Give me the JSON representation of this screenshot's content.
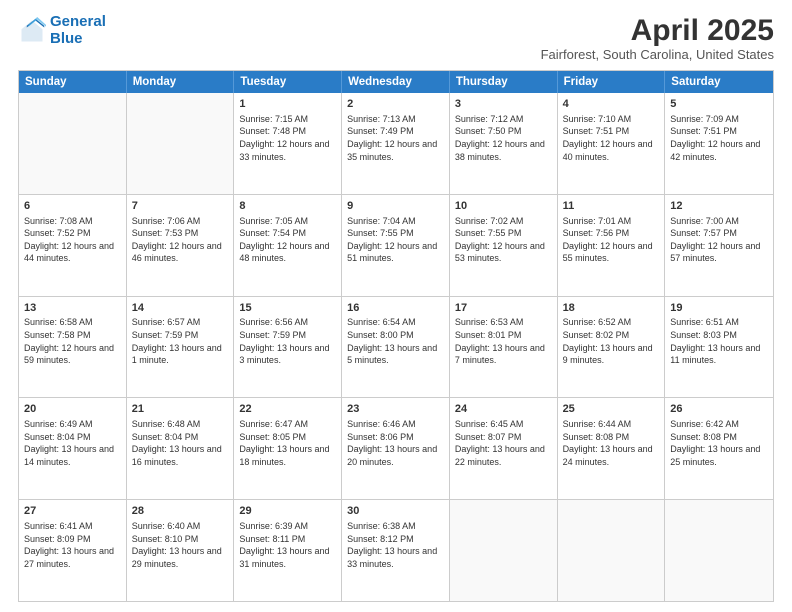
{
  "logo": {
    "line1": "General",
    "line2": "Blue"
  },
  "title": "April 2025",
  "subtitle": "Fairforest, South Carolina, United States",
  "days_of_week": [
    "Sunday",
    "Monday",
    "Tuesday",
    "Wednesday",
    "Thursday",
    "Friday",
    "Saturday"
  ],
  "weeks": [
    [
      {
        "day": "",
        "sunrise": "",
        "sunset": "",
        "daylight": "",
        "empty": true
      },
      {
        "day": "",
        "sunrise": "",
        "sunset": "",
        "daylight": "",
        "empty": true
      },
      {
        "day": "1",
        "sunrise": "Sunrise: 7:15 AM",
        "sunset": "Sunset: 7:48 PM",
        "daylight": "Daylight: 12 hours and 33 minutes."
      },
      {
        "day": "2",
        "sunrise": "Sunrise: 7:13 AM",
        "sunset": "Sunset: 7:49 PM",
        "daylight": "Daylight: 12 hours and 35 minutes."
      },
      {
        "day": "3",
        "sunrise": "Sunrise: 7:12 AM",
        "sunset": "Sunset: 7:50 PM",
        "daylight": "Daylight: 12 hours and 38 minutes."
      },
      {
        "day": "4",
        "sunrise": "Sunrise: 7:10 AM",
        "sunset": "Sunset: 7:51 PM",
        "daylight": "Daylight: 12 hours and 40 minutes."
      },
      {
        "day": "5",
        "sunrise": "Sunrise: 7:09 AM",
        "sunset": "Sunset: 7:51 PM",
        "daylight": "Daylight: 12 hours and 42 minutes."
      }
    ],
    [
      {
        "day": "6",
        "sunrise": "Sunrise: 7:08 AM",
        "sunset": "Sunset: 7:52 PM",
        "daylight": "Daylight: 12 hours and 44 minutes."
      },
      {
        "day": "7",
        "sunrise": "Sunrise: 7:06 AM",
        "sunset": "Sunset: 7:53 PM",
        "daylight": "Daylight: 12 hours and 46 minutes."
      },
      {
        "day": "8",
        "sunrise": "Sunrise: 7:05 AM",
        "sunset": "Sunset: 7:54 PM",
        "daylight": "Daylight: 12 hours and 48 minutes."
      },
      {
        "day": "9",
        "sunrise": "Sunrise: 7:04 AM",
        "sunset": "Sunset: 7:55 PM",
        "daylight": "Daylight: 12 hours and 51 minutes."
      },
      {
        "day": "10",
        "sunrise": "Sunrise: 7:02 AM",
        "sunset": "Sunset: 7:55 PM",
        "daylight": "Daylight: 12 hours and 53 minutes."
      },
      {
        "day": "11",
        "sunrise": "Sunrise: 7:01 AM",
        "sunset": "Sunset: 7:56 PM",
        "daylight": "Daylight: 12 hours and 55 minutes."
      },
      {
        "day": "12",
        "sunrise": "Sunrise: 7:00 AM",
        "sunset": "Sunset: 7:57 PM",
        "daylight": "Daylight: 12 hours and 57 minutes."
      }
    ],
    [
      {
        "day": "13",
        "sunrise": "Sunrise: 6:58 AM",
        "sunset": "Sunset: 7:58 PM",
        "daylight": "Daylight: 12 hours and 59 minutes."
      },
      {
        "day": "14",
        "sunrise": "Sunrise: 6:57 AM",
        "sunset": "Sunset: 7:59 PM",
        "daylight": "Daylight: 13 hours and 1 minute."
      },
      {
        "day": "15",
        "sunrise": "Sunrise: 6:56 AM",
        "sunset": "Sunset: 7:59 PM",
        "daylight": "Daylight: 13 hours and 3 minutes."
      },
      {
        "day": "16",
        "sunrise": "Sunrise: 6:54 AM",
        "sunset": "Sunset: 8:00 PM",
        "daylight": "Daylight: 13 hours and 5 minutes."
      },
      {
        "day": "17",
        "sunrise": "Sunrise: 6:53 AM",
        "sunset": "Sunset: 8:01 PM",
        "daylight": "Daylight: 13 hours and 7 minutes."
      },
      {
        "day": "18",
        "sunrise": "Sunrise: 6:52 AM",
        "sunset": "Sunset: 8:02 PM",
        "daylight": "Daylight: 13 hours and 9 minutes."
      },
      {
        "day": "19",
        "sunrise": "Sunrise: 6:51 AM",
        "sunset": "Sunset: 8:03 PM",
        "daylight": "Daylight: 13 hours and 11 minutes."
      }
    ],
    [
      {
        "day": "20",
        "sunrise": "Sunrise: 6:49 AM",
        "sunset": "Sunset: 8:04 PM",
        "daylight": "Daylight: 13 hours and 14 minutes."
      },
      {
        "day": "21",
        "sunrise": "Sunrise: 6:48 AM",
        "sunset": "Sunset: 8:04 PM",
        "daylight": "Daylight: 13 hours and 16 minutes."
      },
      {
        "day": "22",
        "sunrise": "Sunrise: 6:47 AM",
        "sunset": "Sunset: 8:05 PM",
        "daylight": "Daylight: 13 hours and 18 minutes."
      },
      {
        "day": "23",
        "sunrise": "Sunrise: 6:46 AM",
        "sunset": "Sunset: 8:06 PM",
        "daylight": "Daylight: 13 hours and 20 minutes."
      },
      {
        "day": "24",
        "sunrise": "Sunrise: 6:45 AM",
        "sunset": "Sunset: 8:07 PM",
        "daylight": "Daylight: 13 hours and 22 minutes."
      },
      {
        "day": "25",
        "sunrise": "Sunrise: 6:44 AM",
        "sunset": "Sunset: 8:08 PM",
        "daylight": "Daylight: 13 hours and 24 minutes."
      },
      {
        "day": "26",
        "sunrise": "Sunrise: 6:42 AM",
        "sunset": "Sunset: 8:08 PM",
        "daylight": "Daylight: 13 hours and 25 minutes."
      }
    ],
    [
      {
        "day": "27",
        "sunrise": "Sunrise: 6:41 AM",
        "sunset": "Sunset: 8:09 PM",
        "daylight": "Daylight: 13 hours and 27 minutes."
      },
      {
        "day": "28",
        "sunrise": "Sunrise: 6:40 AM",
        "sunset": "Sunset: 8:10 PM",
        "daylight": "Daylight: 13 hours and 29 minutes."
      },
      {
        "day": "29",
        "sunrise": "Sunrise: 6:39 AM",
        "sunset": "Sunset: 8:11 PM",
        "daylight": "Daylight: 13 hours and 31 minutes."
      },
      {
        "day": "30",
        "sunrise": "Sunrise: 6:38 AM",
        "sunset": "Sunset: 8:12 PM",
        "daylight": "Daylight: 13 hours and 33 minutes."
      },
      {
        "day": "",
        "sunrise": "",
        "sunset": "",
        "daylight": "",
        "empty": true
      },
      {
        "day": "",
        "sunrise": "",
        "sunset": "",
        "daylight": "",
        "empty": true
      },
      {
        "day": "",
        "sunrise": "",
        "sunset": "",
        "daylight": "",
        "empty": true
      }
    ]
  ]
}
